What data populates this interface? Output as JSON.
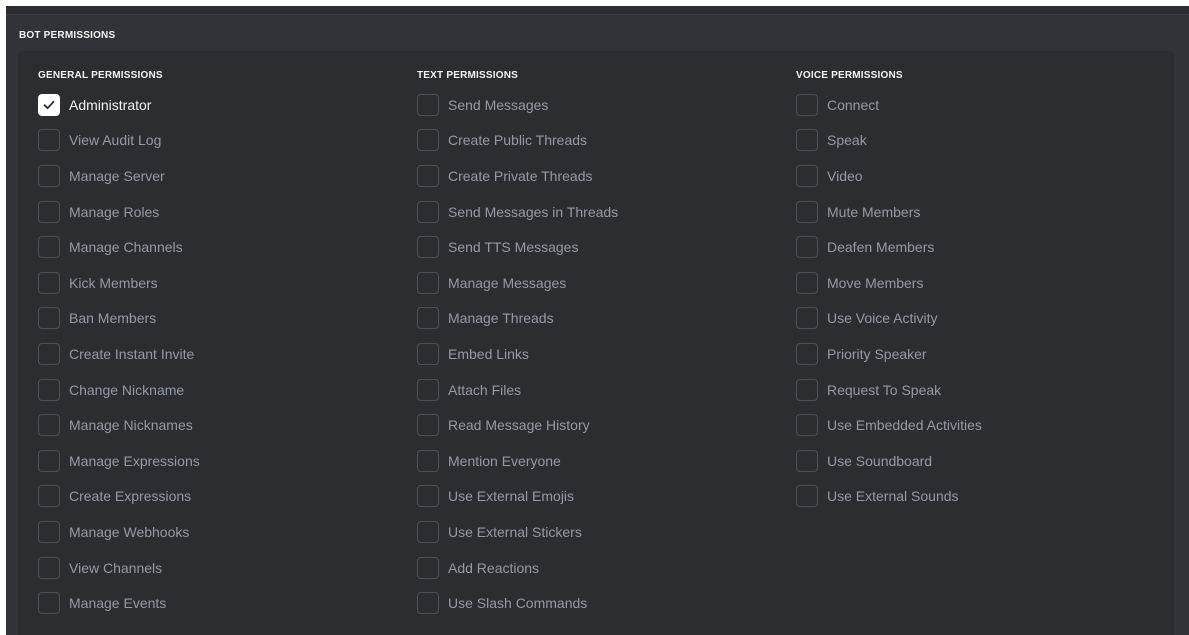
{
  "section_title": "BOT PERMISSIONS",
  "columns": [
    {
      "title": "GENERAL PERMISSIONS",
      "items": [
        {
          "label": "Administrator",
          "checked": true
        },
        {
          "label": "View Audit Log",
          "checked": false
        },
        {
          "label": "Manage Server",
          "checked": false
        },
        {
          "label": "Manage Roles",
          "checked": false
        },
        {
          "label": "Manage Channels",
          "checked": false
        },
        {
          "label": "Kick Members",
          "checked": false
        },
        {
          "label": "Ban Members",
          "checked": false
        },
        {
          "label": "Create Instant Invite",
          "checked": false
        },
        {
          "label": "Change Nickname",
          "checked": false
        },
        {
          "label": "Manage Nicknames",
          "checked": false
        },
        {
          "label": "Manage Expressions",
          "checked": false
        },
        {
          "label": "Create Expressions",
          "checked": false
        },
        {
          "label": "Manage Webhooks",
          "checked": false
        },
        {
          "label": "View Channels",
          "checked": false
        },
        {
          "label": "Manage Events",
          "checked": false
        }
      ]
    },
    {
      "title": "TEXT PERMISSIONS",
      "items": [
        {
          "label": "Send Messages",
          "checked": false
        },
        {
          "label": "Create Public Threads",
          "checked": false
        },
        {
          "label": "Create Private Threads",
          "checked": false
        },
        {
          "label": "Send Messages in Threads",
          "checked": false
        },
        {
          "label": "Send TTS Messages",
          "checked": false
        },
        {
          "label": "Manage Messages",
          "checked": false
        },
        {
          "label": "Manage Threads",
          "checked": false
        },
        {
          "label": "Embed Links",
          "checked": false
        },
        {
          "label": "Attach Files",
          "checked": false
        },
        {
          "label": "Read Message History",
          "checked": false
        },
        {
          "label": "Mention Everyone",
          "checked": false
        },
        {
          "label": "Use External Emojis",
          "checked": false
        },
        {
          "label": "Use External Stickers",
          "checked": false
        },
        {
          "label": "Add Reactions",
          "checked": false
        },
        {
          "label": "Use Slash Commands",
          "checked": false
        }
      ]
    },
    {
      "title": "VOICE PERMISSIONS",
      "items": [
        {
          "label": "Connect",
          "checked": false
        },
        {
          "label": "Speak",
          "checked": false
        },
        {
          "label": "Video",
          "checked": false
        },
        {
          "label": "Mute Members",
          "checked": false
        },
        {
          "label": "Deafen Members",
          "checked": false
        },
        {
          "label": "Move Members",
          "checked": false
        },
        {
          "label": "Use Voice Activity",
          "checked": false
        },
        {
          "label": "Priority Speaker",
          "checked": false
        },
        {
          "label": "Request To Speak",
          "checked": false
        },
        {
          "label": "Use Embedded Activities",
          "checked": false
        },
        {
          "label": "Use Soundboard",
          "checked": false
        },
        {
          "label": "Use External Sounds",
          "checked": false
        }
      ]
    }
  ],
  "icons": {
    "checked": "checkmark-icon"
  },
  "colors": {
    "page_bg": "#313338",
    "panel_bg": "#2b2d31",
    "checkbox_border": "#4e5058",
    "label_muted": "#949ba4",
    "label_active": "#f2f3f5",
    "checked_fill": "#ffffff",
    "check_mark": "#2b2d31"
  }
}
